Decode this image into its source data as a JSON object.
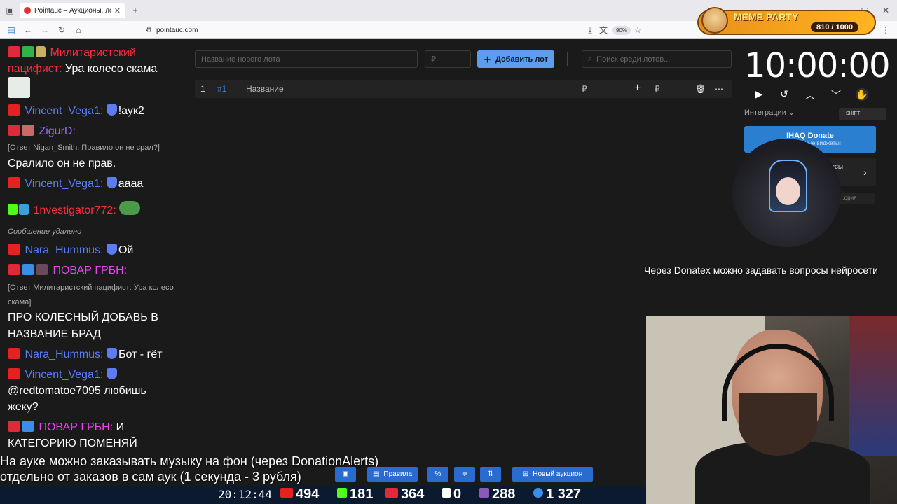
{
  "browser": {
    "tab_title": "Pointauc – Аукционы, лотереи",
    "url": "pointauc.com",
    "zoom": "90%"
  },
  "overlay_badge": {
    "name": "MEME PARTY",
    "count": "810 / 1000"
  },
  "chat": {
    "m1_nick1": "Милитаристский",
    "m1_nick2": "пацифист:",
    "m1_text": "Ура колесо скама",
    "m2_nick": "Vincent_Vega1:",
    "m2_text": "!аук2",
    "m3_nick": "ZigurD:",
    "m3_reply": "[Ответ Nigan_Smith: Правило он не срал?]",
    "m3_text": "Сралило он не прав.",
    "m4_nick": "Vincent_Vega1:",
    "m4_text": "аааа",
    "m5_nick": "1nvestigator772:",
    "deleted": "Сообщение удалено",
    "m6_nick": "Nara_Hummus:",
    "m6_text": "Ой",
    "m7_nick": "ПОВАР ГРБН:",
    "m7_reply1": "[Ответ Милитаристский пацифист: Ура колесо",
    "m7_reply2": "скама]",
    "m7_text1": "ПРО КОЛЕСНЫЙ ДОБАВЬ В",
    "m7_text2": "НАЗВАНИЕ БРАД",
    "m8_nick": "Nara_Hummus:",
    "m8_text": "Бот - гёт",
    "m9_nick": "Vincent_Vega1:",
    "m9_text1": "@redtomatoe7095 любишь",
    "m9_text2": "жеку?",
    "m10_nick": "ПОВАР ГРБН:",
    "m10_text1": "И",
    "m10_text2": "КАТЕГОРИЮ ПОМЕНЯЙ"
  },
  "auction": {
    "new_lot_placeholder": "Название нового лота",
    "currency": "₽",
    "add_lot": "Добавить лот",
    "search_placeholder": "Поиск среди лотов...",
    "lot_index": "1",
    "lot_id": "#1",
    "lot_name": "Название",
    "lot_currency": "₽",
    "lot_currency2": "₽"
  },
  "timer": {
    "value": "10:00:00"
  },
  "integrations": {
    "label": "Интеграции",
    "shift": "SHIFT",
    "ihaq_title": "IHAQ Donate",
    "ihaq_sub": "...уникальные виджеты!",
    "services_label": "...исы",
    "history": "...ория"
  },
  "overlay_text": {
    "donatex": "Через Donatex можно задавать вопросы нейросети",
    "music1": "На ауке можно заказывать музыку на фон (через DonationAlerts)",
    "music2": "отдельно от заказов в сам аук (1 секунда - 3 рубля)"
  },
  "toolbar": {
    "rules": "Правила",
    "percent": "%",
    "new_auction": "Новый аукцион"
  },
  "status": {
    "time": "20:12:44",
    "youtube": "494",
    "kick": "181",
    "live": "364",
    "r": "0",
    "other": "288",
    "viewers": "1 327"
  }
}
